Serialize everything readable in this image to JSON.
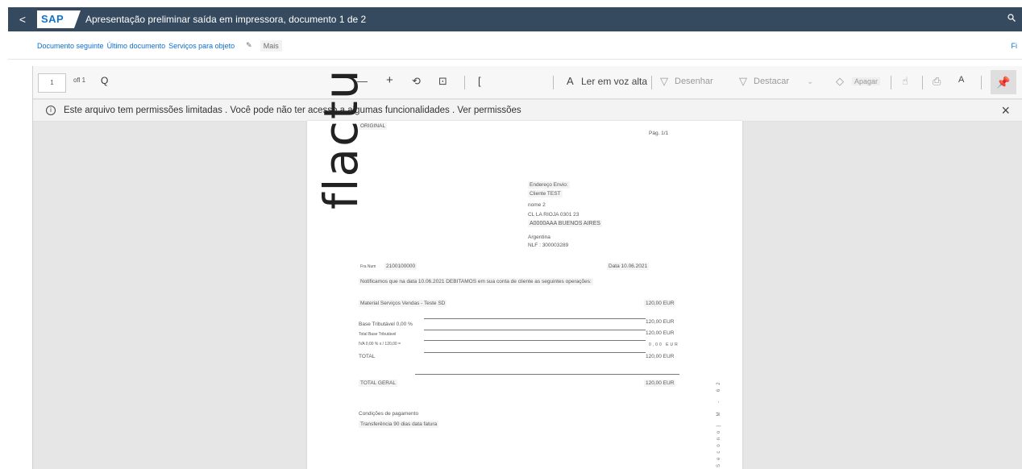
{
  "shell": {
    "back": "<",
    "logo": "SAP",
    "title": "Apresentação preliminar saída em impressora, documento 1 de 2"
  },
  "subbar": {
    "next_doc": "Documento seguinte",
    "last_doc": "Último documento",
    "services": "Serviços para objeto",
    "more": "Mais",
    "right_link": "Fi"
  },
  "pdf_toolbar": {
    "page_input": "1",
    "page_count": "ofl 1",
    "search": "Q",
    "zoom_out": "—",
    "zoom_in": "+",
    "rotate": "⟲",
    "fit": "⊡",
    "page_view": "[",
    "read_aloud_icon": "A",
    "read_aloud": "Ler em voz alta",
    "draw": "Desenhar",
    "highlight": "Destacar",
    "erase": "Apagar",
    "text_tool": "A"
  },
  "infobar": {
    "icon": "i",
    "message": "Este arquivo tem permissões limitadas . Você pode não ter acesso a algumas funcionalidades . Ver permissões"
  },
  "document": {
    "original": "ORIGINAL",
    "page_label": "Pág. 1/1",
    "watermark": "flactu",
    "address": {
      "header": "Endereço Envio:",
      "client": "Cliente TEST",
      "name": "nome 2",
      "street": "CL LA RIOJA 0301 23",
      "city": "A0000AAA BUENOS AIRES",
      "country": "Argentina",
      "nif": "NLF : 300003289"
    },
    "invoice_label": "Fra Num",
    "invoice_number": "2100100000",
    "date": "Data 10.06.2021",
    "notification": "Notificamos que na data 10.06.2021 DEBITAMOS em sua conta de cliente as seguintes operações:",
    "item_desc": "Material Serviços Vendas - Teste SD",
    "item_amount": "120,00 EUR",
    "base_label": "Base Tributável 0,00 %",
    "base_amount": "120,00 EUR",
    "total_base_label": "Total Base Tributável",
    "total_base_amount": "120,00 EUR",
    "iva_label": "IVA 0,00 % x / 120,00 =",
    "iva_amount": "0,00 EUR",
    "total_label": "TOTAL",
    "total_amount": "120,00 EUR",
    "grand_total_label": "TOTAL GERAL",
    "grand_total_amount": "120,00 EUR",
    "payment_header": "Condições de pagamento",
    "payment_terms": "Transferência 90 dias data fatura",
    "vertical_text": "Secono| M - 62"
  }
}
